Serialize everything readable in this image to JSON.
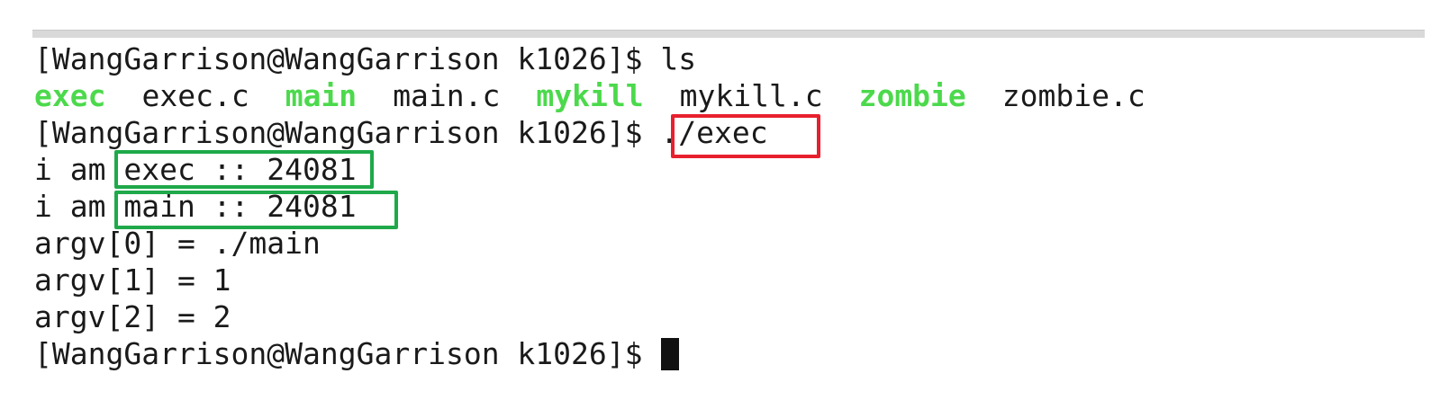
{
  "terminal": {
    "prompt": "[WangGarrison@WangGarrison k1026]$",
    "top_partial_line": "- - - - - - - - - - - - - - - - - - - - - - - - - - - - - -",
    "commands": {
      "ls": "ls",
      "exec": "./exec"
    },
    "ls_output": [
      {
        "name": "exec",
        "kind": "executable"
      },
      {
        "name": "exec.c",
        "kind": "file"
      },
      {
        "name": "main",
        "kind": "executable"
      },
      {
        "name": "main.c",
        "kind": "file"
      },
      {
        "name": "mykill",
        "kind": "executable"
      },
      {
        "name": "mykill.c",
        "kind": "file"
      },
      {
        "name": "zombie",
        "kind": "executable"
      },
      {
        "name": "zombie.c",
        "kind": "file"
      }
    ],
    "output_lines": {
      "line1_prefix": "i am ",
      "line1_value": "exec :: 24081",
      "line2_prefix": "i am ",
      "line2_value": "main :: 24081",
      "argv0": "argv[0] = ./main",
      "argv1": "argv[1] = 1",
      "argv2": "argv[2] = 2"
    }
  },
  "colors": {
    "executable": "#4cd94c",
    "highlight_red": "#e8202e",
    "highlight_green": "#1fa94a",
    "text": "#1a1a1a",
    "background": "#ffffff"
  }
}
